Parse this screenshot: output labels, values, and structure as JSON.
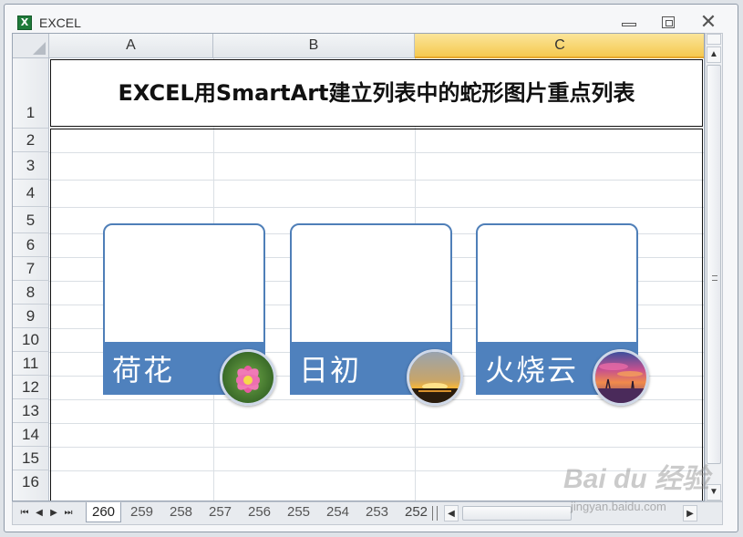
{
  "window": {
    "title": "EXCEL",
    "app_icon": "excel-icon"
  },
  "sheet": {
    "columns": [
      {
        "label": "A",
        "selected": false
      },
      {
        "label": "B",
        "selected": false
      },
      {
        "label": "C",
        "selected": true
      }
    ],
    "rows": [
      "1",
      "2",
      "3",
      "4",
      "5",
      "6",
      "7",
      "8",
      "9",
      "10",
      "11",
      "12",
      "13",
      "14",
      "15",
      "16"
    ],
    "title": "EXCEL用SmartArt建立列表中的蛇形图片重点列表"
  },
  "smartart": {
    "items": [
      {
        "label": "荷花",
        "picture": "lotus-photo"
      },
      {
        "label": "日初",
        "picture": "sunrise-photo"
      },
      {
        "label": "火烧云",
        "picture": "sunset-clouds-photo"
      }
    ],
    "accent_color": "#4f81bd"
  },
  "tabs": {
    "sheets": [
      "260",
      "259",
      "258",
      "257",
      "256",
      "255",
      "254",
      "253",
      "252"
    ],
    "active": "260"
  },
  "watermark": {
    "brand": "Bai du 经验",
    "url": "jingyan.baidu.com"
  }
}
